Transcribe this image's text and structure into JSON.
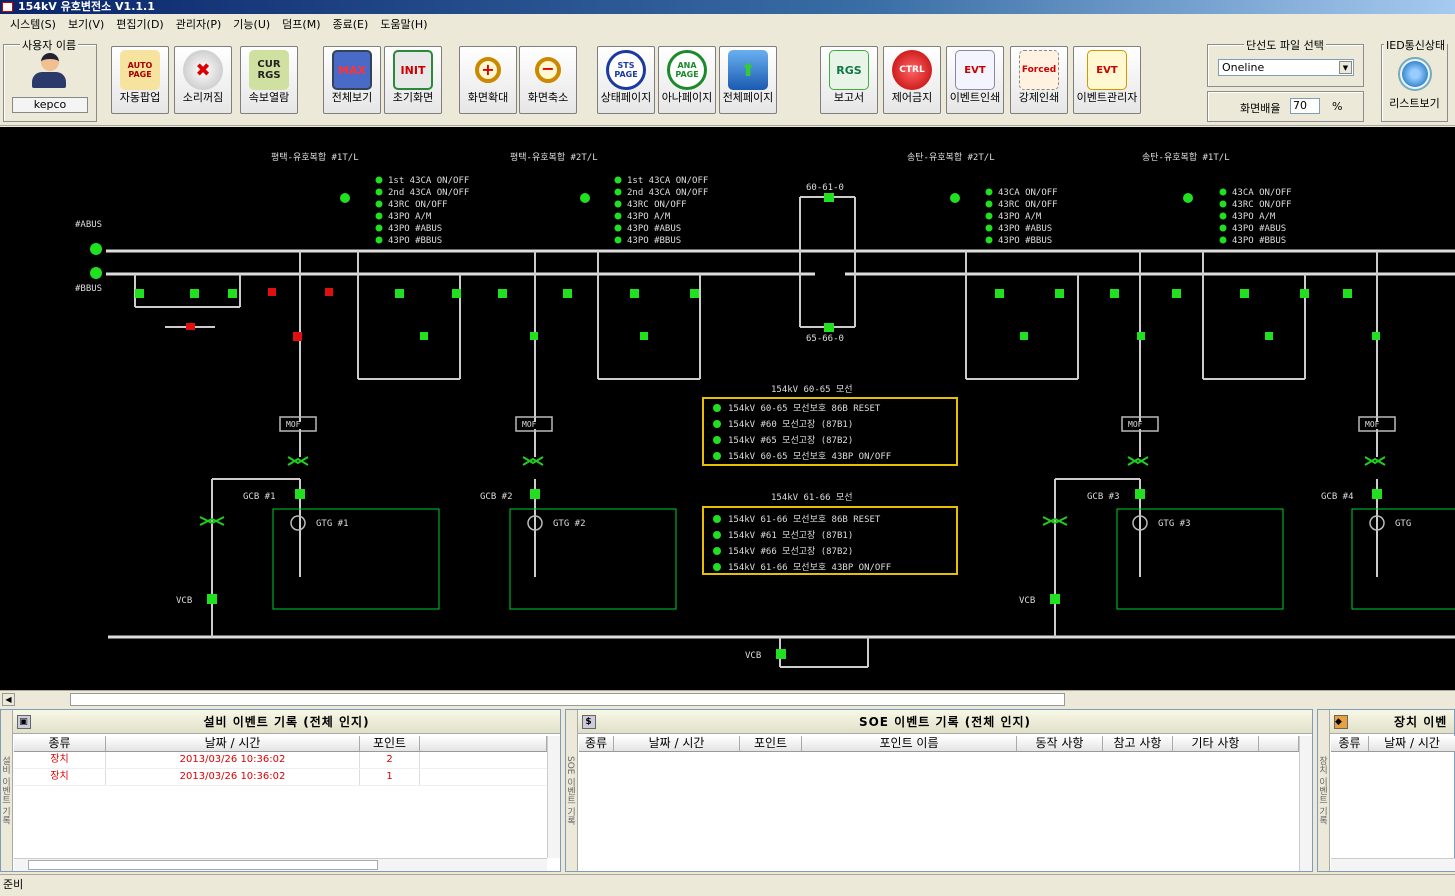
{
  "window": {
    "title": "154kV 유호변전소 V1.1.1"
  },
  "menu": [
    "시스템(S)",
    "보기(V)",
    "편집기(D)",
    "관리자(P)",
    "기능(U)",
    "덤프(M)",
    "종료(E)",
    "도움말(H)"
  ],
  "user": {
    "group_label": "사용자 이름",
    "name": "kepco"
  },
  "toolbar": {
    "auto_popup": "자동팝업",
    "sound_off": "소리꺼짐",
    "cur_view": "속보열람",
    "full_view": "전체보기",
    "init_screen": "초기화면",
    "zoom_in": "화면확대",
    "zoom_out": "화면축소",
    "status_page": "상태페이지",
    "analog_page": "아나페이지",
    "all_page": "전체페이지",
    "report": "보고서",
    "ctrl_block": "제어금지",
    "event_print": "이벤트인쇄",
    "forced_print": "강제인쇄",
    "event_manager": "이벤트관리자"
  },
  "icons": {
    "auto": "AUTO PAGE",
    "cur": "CUR RGS",
    "max": "MAX",
    "init": "INIT",
    "sts": "STS PAGE",
    "ana": "ANA PAGE",
    "rgs": "RGS",
    "ctrl": "CTRL",
    "evt": "EVT",
    "forced": "Forced"
  },
  "oneline": {
    "group_label": "단선도 파일 선택",
    "selected": "Oneline",
    "zoom_label": "화면배율",
    "zoom_value": "70",
    "zoom_unit": "%"
  },
  "ied": {
    "group_label": "IED통신상태",
    "button": "리스트보기"
  },
  "scada": {
    "feeders": [
      "평택-유호복합 #1T/L",
      "평택-유호복합 #2T/L",
      "송탄-유호복합 #2T/L",
      "송탄-유호복합 #1T/L"
    ],
    "bus_a": "#ABUS",
    "bus_b": "#BBUS",
    "box1_title": "154kV 60-65 모선",
    "box1_items": [
      "154kV 60-65 모선보호 86B RESET",
      "154kV #60 모선고장 (87B1)",
      "154kV #65 모선고장 (87B2)",
      "154kV 60-65 모선보호 43BP ON/OFF"
    ],
    "box2_title": "154kV 61-66 모선",
    "box2_items": [
      "154kV 61-66 모선보호 86B RESET",
      "154kV #61 모선고장 (87B1)",
      "154kV #66 모선고장 (87B2)",
      "154kV 61-66 모선보호 43BP ON/OFF"
    ],
    "feeder_items_l": [
      "1st 43CA ON/OFF",
      "2nd 43CA ON/OFF",
      "43RC ON/OFF",
      "43PO A/M",
      "43PO #ABUS",
      "43PO #BBUS"
    ],
    "feeder_items_r": [
      "43CA ON/OFF",
      "43RC ON/OFF",
      "43PO A/M",
      "43PO #ABUS",
      "43PO #BBUS"
    ],
    "gtg": [
      "GTG #1",
      "GTG #2",
      "GTG #3",
      "GTG"
    ],
    "gcb": [
      "GCB #1",
      "GCB #2",
      "GCB #3",
      "GCB #4"
    ],
    "mof": "MOF",
    "vcb": "VCB",
    "bus_tie_top": "60-61-0",
    "bus_tie_bot": "65-66-0"
  },
  "panels": {
    "facility": {
      "title": "설비 이벤트 기록 (전체 인지)",
      "side": "설비 이벤트 기록",
      "columns": [
        "종류",
        "날짜 / 시간",
        "포인트"
      ],
      "rows": [
        {
          "type": "장치",
          "time": "2013/03/26 10:36:02",
          "point": "2"
        },
        {
          "type": "장치",
          "time": "2013/03/26 10:36:02",
          "point": "1"
        }
      ]
    },
    "soe": {
      "title": "SOE 이벤트 기록 (전체 인지)",
      "side": "SOE 이벤트 기록",
      "columns": [
        "종류",
        "날짜 / 시간",
        "포인트",
        "포인트 이름",
        "동작 사항",
        "참고 사항",
        "기타 사항"
      ]
    },
    "device": {
      "title": "장치 이벤",
      "side": "장치 이벤트 기록",
      "columns": [
        "종류",
        "날짜 / 시간"
      ]
    }
  },
  "status": "준비"
}
